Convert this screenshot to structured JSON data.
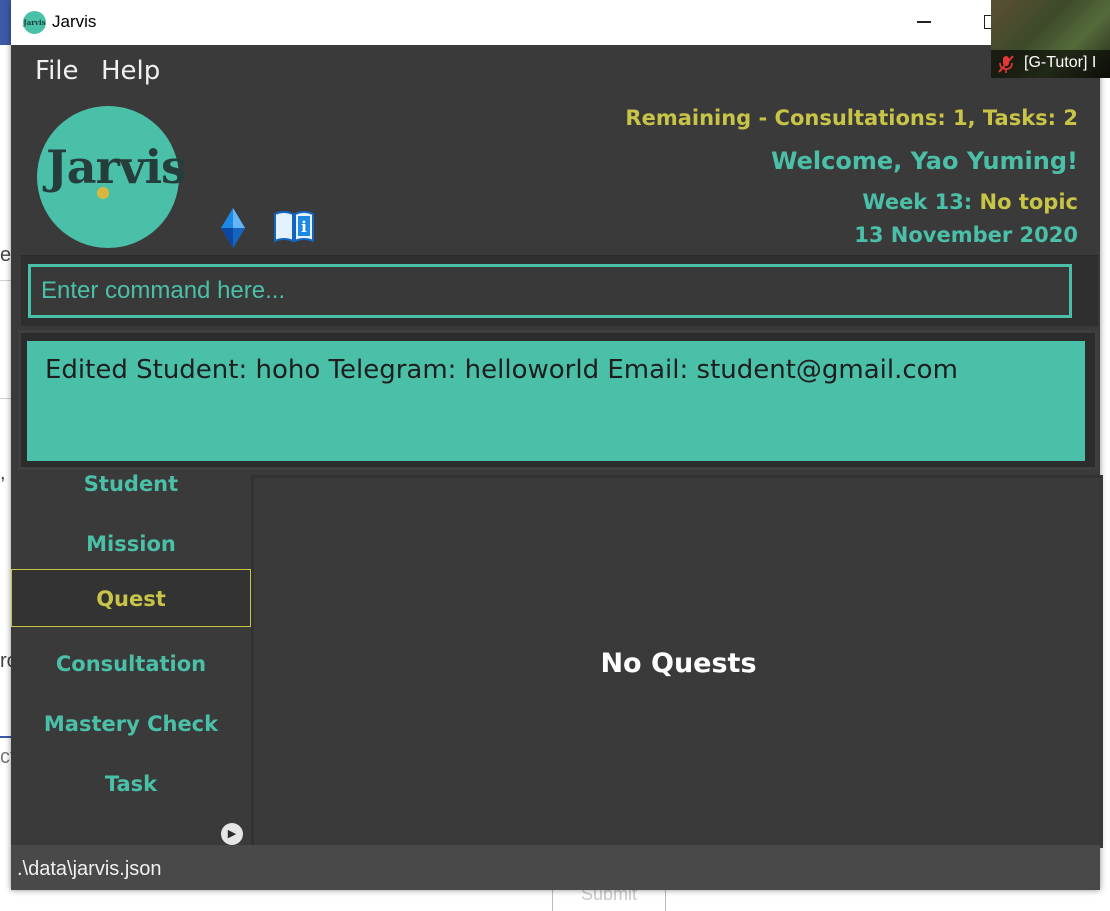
{
  "background": {
    "fragments": [
      "es",
      ",",
      "ro",
      "ct"
    ],
    "submit_label": "Submit"
  },
  "window": {
    "title": "Jarvis",
    "icon_label": "Jarvis"
  },
  "video_overlay": {
    "participant": "[G-Tutor] I",
    "icon": "mic-muted-icon"
  },
  "menu": {
    "file": "File",
    "help": "Help"
  },
  "header": {
    "logo_text": "Jarvis",
    "remaining": "Remaining - Consultations: 1, Tasks: 2",
    "welcome": "Welcome, Yao Yuming!",
    "week_label": "Week 13:",
    "week_topic": "No topic",
    "date": "13 November 2020",
    "icons": [
      "crystal-icon",
      "book-info-icon"
    ]
  },
  "command": {
    "placeholder": "Enter command here..."
  },
  "result": {
    "message": "Edited Student: hoho Telegram: helloworld Email: student@gmail.com"
  },
  "tabs": [
    {
      "label": "Student"
    },
    {
      "label": "Mission"
    },
    {
      "label": "Quest",
      "active": true
    },
    {
      "label": "Consultation"
    },
    {
      "label": "Mastery Check"
    },
    {
      "label": "Task"
    }
  ],
  "main": {
    "empty_message": "No Quests"
  },
  "status": {
    "file_path": ".\\data\\jarvis.json"
  },
  "colors": {
    "teal": "#4bc0a8",
    "yellow": "#c8c447",
    "dark": "#3a3a3a"
  }
}
